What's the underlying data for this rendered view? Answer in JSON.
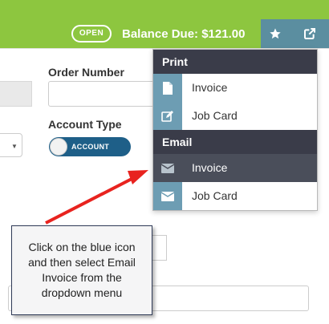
{
  "header": {
    "status": "OPEN",
    "balance": "Balance Due: $121.00",
    "star_icon": "star-icon",
    "external_icon": "external-link-icon",
    "color": "#8dc63f"
  },
  "form": {
    "order_number_label": "Order Number",
    "order_number_value": "",
    "account_type_label": "Account Type",
    "account_toggle": "ACCOUNT"
  },
  "dropdown": {
    "print_header": "Print",
    "print_items": [
      {
        "label": "Invoice",
        "icon": "file-icon"
      },
      {
        "label": "Job Card",
        "icon": "edit-icon"
      }
    ],
    "email_header": "Email",
    "email_items": [
      {
        "label": "Invoice",
        "icon": "envelope-icon",
        "active": true
      },
      {
        "label": "Job Card",
        "icon": "envelope-icon",
        "active": false
      }
    ]
  },
  "callout": {
    "text": "Click on the blue icon and then select Email Invoice from the dropdown menu"
  }
}
